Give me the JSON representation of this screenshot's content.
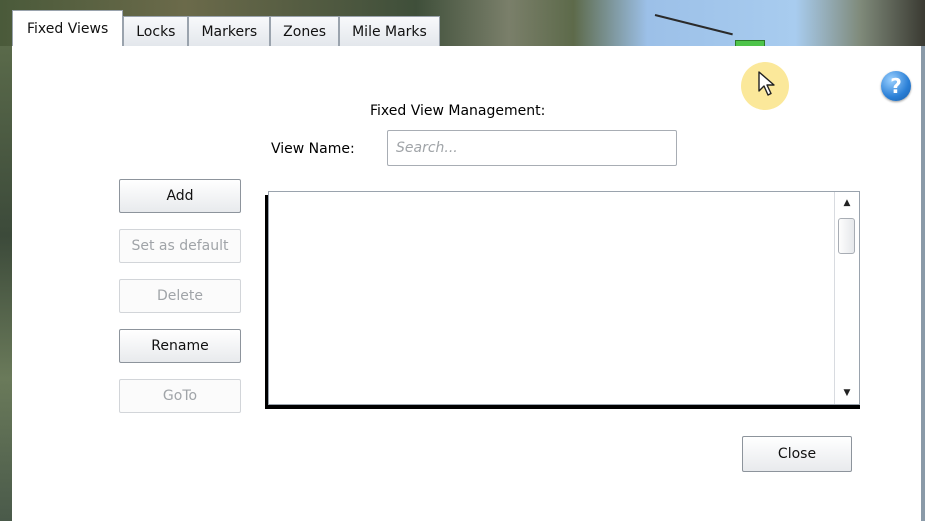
{
  "tabs": [
    {
      "label": "Fixed Views",
      "active": true
    },
    {
      "label": "Locks",
      "active": false
    },
    {
      "label": "Markers",
      "active": false
    },
    {
      "label": "Zones",
      "active": false
    },
    {
      "label": "Mile Marks",
      "active": false
    }
  ],
  "header": {
    "title": "Fixed View Management:",
    "help_icon": "question-mark-icon",
    "help_glyph": "?"
  },
  "view_name": {
    "label": "View Name:",
    "placeholder": "Search...",
    "value": ""
  },
  "actions": {
    "add": {
      "label": "Add",
      "enabled": true
    },
    "set_default": {
      "label": "Set as default",
      "enabled": false
    },
    "delete": {
      "label": "Delete",
      "enabled": false
    },
    "rename": {
      "label": "Rename",
      "enabled": true
    },
    "goto": {
      "label": "GoTo",
      "enabled": false
    }
  },
  "list": {
    "items": [],
    "scroll_up_glyph": "▲",
    "scroll_down_glyph": "▼"
  },
  "footer": {
    "close_label": "Close"
  },
  "colors": {
    "help_blue": "#2a7fd6",
    "cursor_highlight": "#fbe89a",
    "disabled_text": "#a0a4a8"
  }
}
